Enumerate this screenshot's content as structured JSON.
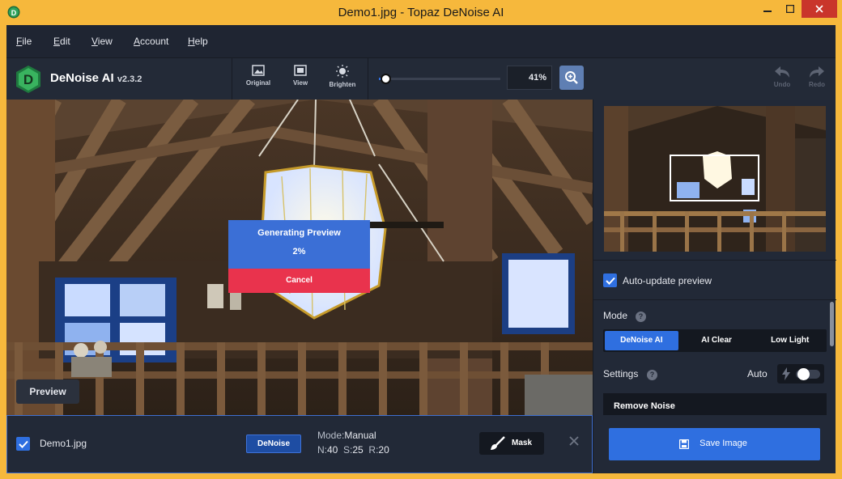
{
  "window": {
    "title": "Demo1.jpg - Topaz DeNoise AI"
  },
  "menu": {
    "items": [
      {
        "key": "F",
        "rest": "ile"
      },
      {
        "key": "E",
        "rest": "dit"
      },
      {
        "key": "V",
        "rest": "iew"
      },
      {
        "key": "A",
        "rest": "ccount"
      },
      {
        "key": "H",
        "rest": "elp"
      }
    ]
  },
  "app": {
    "name": "DeNoise AI",
    "version": "v2.3.2"
  },
  "toolbar": {
    "original": "Original",
    "view": "View",
    "brighten": "Brighten",
    "zoom_value": "41%",
    "zoom_fraction": 0.05,
    "undo": "Undo",
    "redo": "Redo"
  },
  "progress_dialog": {
    "title": "Generating Preview",
    "percent": "2%",
    "cancel": "Cancel"
  },
  "viewer": {
    "preview_button": "Preview"
  },
  "file_bar": {
    "checked": true,
    "file_name": "Demo1.jpg",
    "model_badge": "DeNoise",
    "mode_label": "Mode:",
    "mode_value": "Manual",
    "n_label": "N:",
    "n_value": "40",
    "s_label": "S:",
    "s_value": "25",
    "r_label": "R:",
    "r_value": "20",
    "mask_button": "Mask"
  },
  "side_panel": {
    "auto_update_label": "Auto-update preview",
    "auto_update_checked": true,
    "mode_label": "Mode",
    "mode_tabs": [
      "DeNoise AI",
      "AI Clear",
      "Low Light"
    ],
    "active_mode": "DeNoise AI",
    "settings_label": "Settings",
    "auto_label": "Auto",
    "auto_on": false,
    "section_title": "Remove Noise",
    "save_button": "Save Image"
  },
  "colors": {
    "accent": "#2f6fe0",
    "cancel": "#e9334d",
    "window_border": "#f6b83c"
  }
}
